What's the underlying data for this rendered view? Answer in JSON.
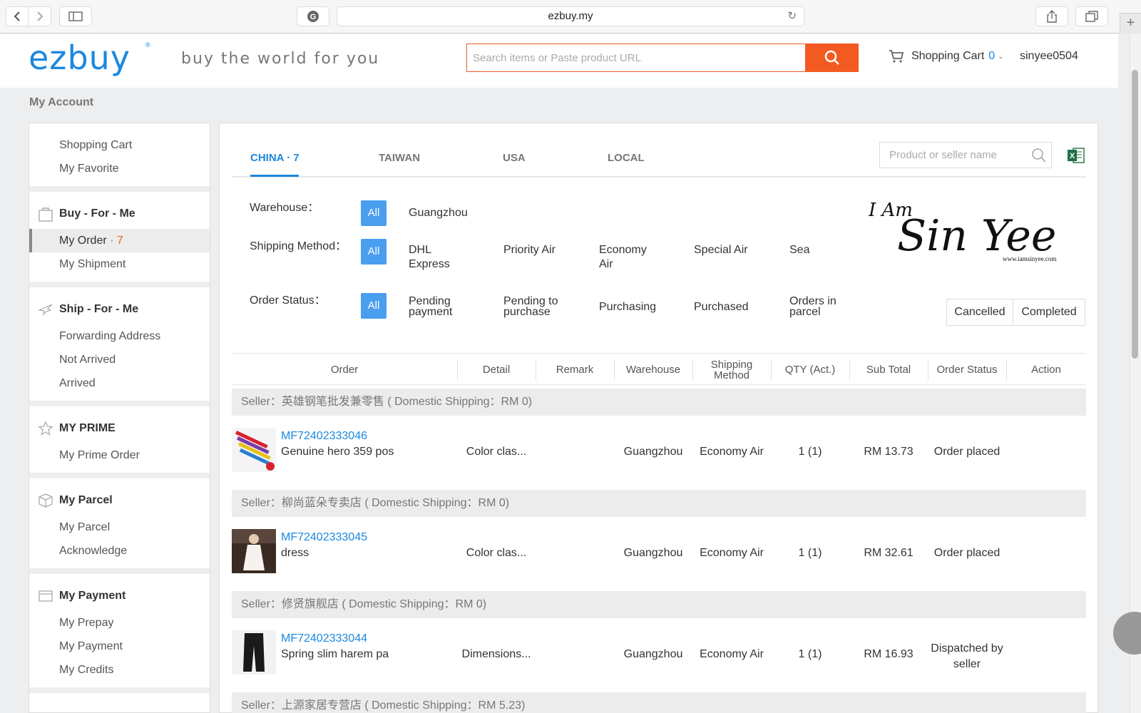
{
  "browser": {
    "url": "ezbuy.my"
  },
  "header": {
    "logo": "ezbuy",
    "logo_mark": "®",
    "tagline": "buy the world for you",
    "search_placeholder": "Search items or Paste product URL",
    "cart_label": "Shopping Cart",
    "cart_count": "0",
    "username": "sinyee0504"
  },
  "page_title": "My Account",
  "sidebar": {
    "top_items": [
      "Shopping Cart",
      "My Favorite"
    ],
    "sections": [
      {
        "title": "Buy - For - Me",
        "icon": "bag-icon",
        "items": [
          "My Order",
          "My Shipment"
        ],
        "active_count": "7"
      },
      {
        "title": "Ship - For - Me",
        "icon": "plane-icon",
        "items": [
          "Forwarding Address",
          "Not Arrived",
          "Arrived"
        ]
      },
      {
        "title": "MY PRIME",
        "icon": "star-icon",
        "items": [
          "My Prime Order"
        ]
      },
      {
        "title": "My Parcel",
        "icon": "box-icon",
        "items": [
          "My Parcel",
          "Acknowledge"
        ]
      },
      {
        "title": "My Payment",
        "icon": "card-icon",
        "items": [
          "My Prepay",
          "My Payment",
          "My Credits"
        ]
      }
    ]
  },
  "tabs": [
    {
      "label": "CHINA · 7",
      "active": true
    },
    {
      "label": "TAIWAN"
    },
    {
      "label": "USA"
    },
    {
      "label": "LOCAL"
    }
  ],
  "filter_search_placeholder": "Product or seller name",
  "filters": {
    "warehouse_label": "Warehouse：",
    "warehouse_options": [
      "Guangzhou"
    ],
    "shipping_label": "Shipping Method：",
    "shipping_options": [
      "DHL Express",
      "Priority Air",
      "Economy Air",
      "Special Air",
      "Sea"
    ],
    "status_label": "Order Status：",
    "status_options": [
      "Pending payment",
      "Pending to purchase",
      "Purchasing",
      "Purchased",
      "Orders in parcel"
    ],
    "all_label": "All",
    "cancelled_label": "Cancelled",
    "completed_label": "Completed"
  },
  "signature": {
    "text_small": "I Am",
    "text_big": "Sin Yee",
    "site": "www.iamsinyee.com"
  },
  "table": {
    "headers": [
      "Order",
      "Detail",
      "Remark",
      "Warehouse",
      "Shipping Method",
      "QTY (Act.)",
      "Sub Total",
      "Order Status",
      "Action"
    ],
    "groups": [
      {
        "seller": "Seller：英雄钢笔批发兼零售 ( Domestic Shipping：RM 0)",
        "order": {
          "id": "MF72402333046",
          "name": "Genuine hero 359 pos",
          "detail": "Color clas...",
          "warehouse": "Guangzhou",
          "shipping": "Economy Air",
          "qty": "1 (1)",
          "subtotal": "RM 13.73",
          "status": "Order placed"
        }
      },
      {
        "seller": "Seller：柳尚蓝朵专卖店 ( Domestic Shipping：RM 0)",
        "order": {
          "id": "MF72402333045",
          "name": "dress",
          "detail": "Color clas...",
          "warehouse": "Guangzhou",
          "shipping": "Economy Air",
          "qty": "1 (1)",
          "subtotal": "RM 32.61",
          "status": "Order placed"
        }
      },
      {
        "seller": "Seller：修贤旗舰店 ( Domestic Shipping：RM 0)",
        "order": {
          "id": "MF72402333044",
          "name": "Spring slim harem pa",
          "detail": "Dimensions...",
          "warehouse": "Guangzhou",
          "shipping": "Economy Air",
          "qty": "1 (1)",
          "subtotal": "RM 16.93",
          "status": "Dispatched by seller"
        }
      }
    ],
    "partial_seller": "Seller：上源家居专营店 ( Domestic Shipping：RM 5.23)"
  },
  "colors": {
    "brand_blue": "#1c88df",
    "brand_orange": "#f35a21",
    "filter_blue": "#4a9ef0"
  }
}
